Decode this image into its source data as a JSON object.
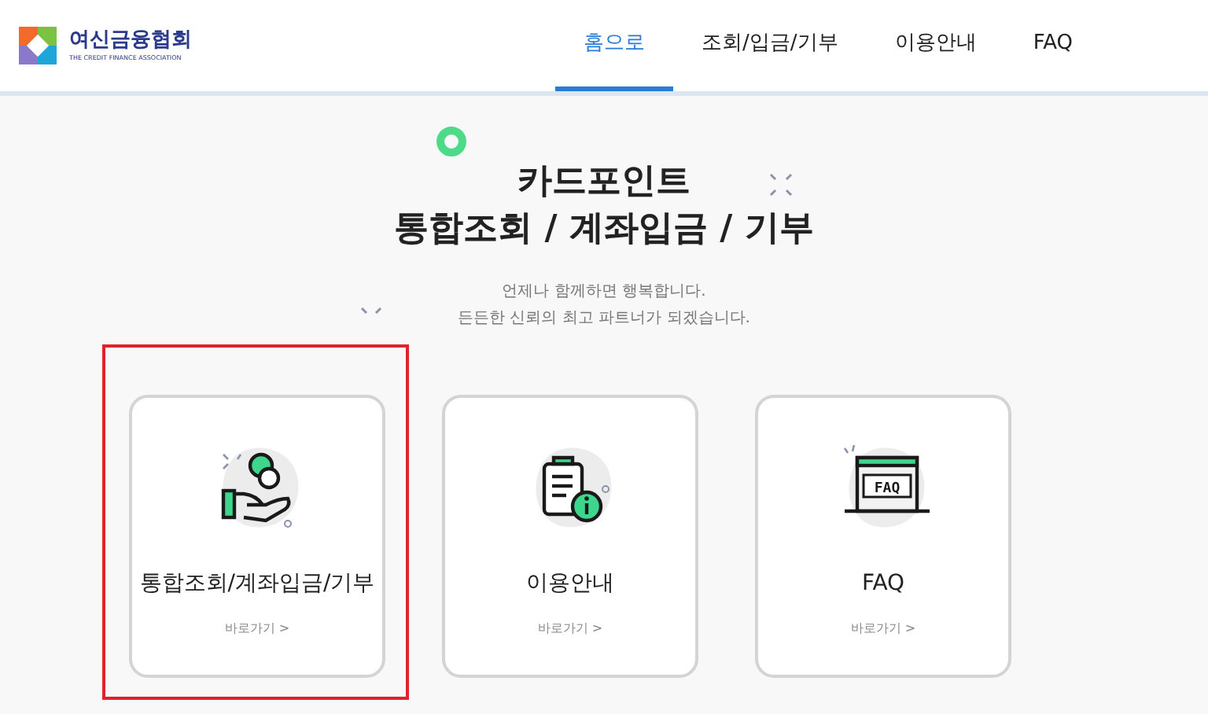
{
  "logo": {
    "name": "여신금융협회",
    "subtitle": "THE CREDIT FINANCE ASSOCIATION"
  },
  "nav": [
    {
      "label": "홈으로",
      "selected": true
    },
    {
      "label": "조회/입금/기부",
      "selected": false
    },
    {
      "label": "이용안내",
      "selected": false
    },
    {
      "label": "FAQ",
      "selected": false
    }
  ],
  "hero": {
    "title_lines": [
      "카드포인트",
      "통합조회 / 계좌입금 / 기부"
    ],
    "subtitle_lines": [
      "언제나 함께하면 행복합니다.",
      "든든한 신뢰의 최고 파트너가 되겠습니다."
    ]
  },
  "cards": [
    {
      "kind": "hand-coin",
      "title": "통합조회/계좌입금/기부",
      "link": "바로가기 >",
      "highlighted": true
    },
    {
      "kind": "clipboard-info",
      "title": "이용안내",
      "link": "바로가기 >",
      "highlighted": false
    },
    {
      "kind": "faq-window",
      "icon_text": "FAQ",
      "title": "FAQ",
      "link": "바로가기 >",
      "highlighted": false
    }
  ]
}
